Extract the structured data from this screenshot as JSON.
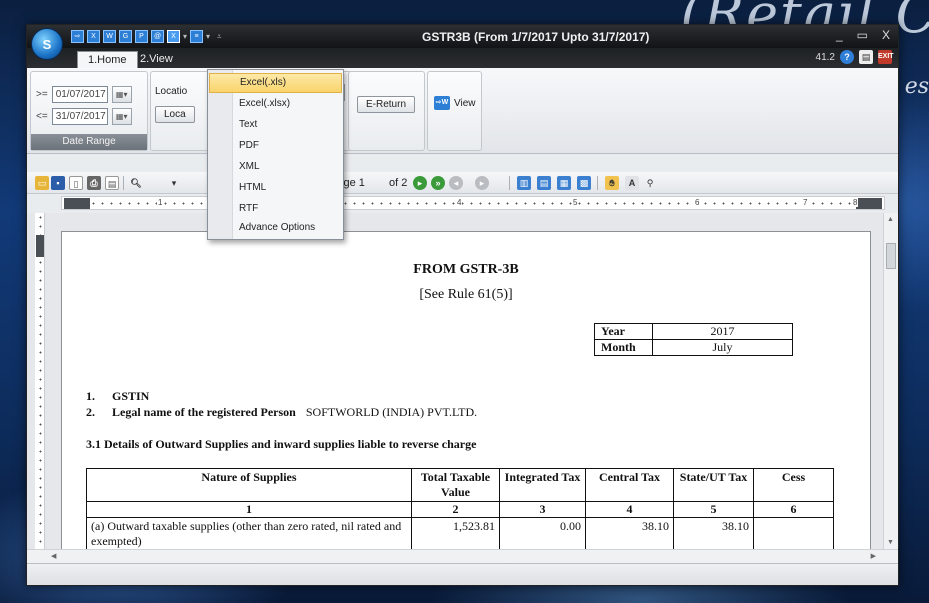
{
  "window": {
    "title": "GSTR3B (From 1/7/2017 Upto 31/7/2017)",
    "version": "41.2",
    "controls": {
      "minimize": "_",
      "restore": "▭",
      "close": "X"
    }
  },
  "background": {
    "brand": "(Retail C",
    "brand_sub": "es"
  },
  "ribbon": {
    "tabs": [
      {
        "label": "1.Home"
      },
      {
        "label": "2.View"
      }
    ],
    "date_range": {
      "from_op": ">=",
      "from_value": "01/07/2017",
      "to_op": "<=",
      "to_value": "31/07/2017",
      "label": "Date Range"
    },
    "location_label": "Locatio",
    "location_button": "Loca",
    "ereturn_button": "E-Return",
    "view_button": "View"
  },
  "export_menu": {
    "items": [
      {
        "label": "Excel(.xls)",
        "highlighted": true
      },
      {
        "label": "Excel(.xlsx)"
      },
      {
        "label": "Text"
      },
      {
        "label": "PDF"
      },
      {
        "label": "XML"
      },
      {
        "label": "HTML"
      },
      {
        "label": "RTF"
      },
      {
        "label": "Advance Options"
      }
    ]
  },
  "toolbar": {
    "page_label": "Page 1",
    "of_label": "of 2"
  },
  "ruler": {
    "marks": [
      "1",
      "3",
      "4",
      "5",
      "6",
      "7",
      "8"
    ]
  },
  "report": {
    "title": "FROM GSTR-3B",
    "subtitle": "[See Rule 61(5)]",
    "year_label": "Year",
    "year_value": "2017",
    "month_label": "Month",
    "month_value": "July",
    "line1": {
      "num": "1.",
      "label": "GSTIN"
    },
    "line2": {
      "num": "2.",
      "label": "Legal name of the registered Person",
      "value": "SOFTWORLD (INDIA) PVT.LTD."
    },
    "section": "3.1 Details of Outward Supplies and inward supplies liable to reverse charge",
    "table": {
      "headers": [
        "Nature of Supplies",
        "Total Taxable Value",
        "Integrated Tax",
        "Central Tax",
        "State/UT Tax",
        "Cess"
      ],
      "index_row": [
        "1",
        "2",
        "3",
        "4",
        "5",
        "6"
      ],
      "rows": [
        {
          "nature": "(a) Outward taxable supplies (other than zero rated, nil rated and exempted)",
          "taxable": "1,523.81",
          "integrated": "0.00",
          "central": "38.10",
          "state": "38.10",
          "cess": ""
        }
      ]
    }
  },
  "colors": {
    "accent": "#2d7fd6",
    "highlight": "#f9d46b",
    "titlebar": "#1a1c1f"
  }
}
